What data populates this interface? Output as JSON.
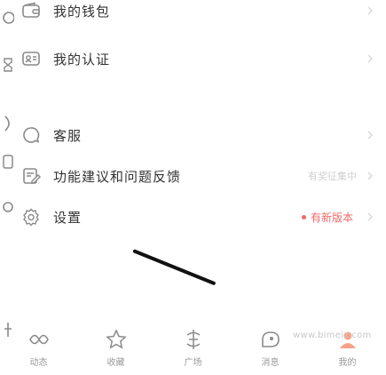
{
  "menu": [
    {
      "label": "我的钱包",
      "icon": "wallet-icon"
    },
    {
      "label": "我的认证",
      "icon": "id-card-icon"
    },
    {
      "label": "客服",
      "icon": "chat-icon"
    },
    {
      "label": "功能建议和问题反馈",
      "icon": "edit-icon",
      "sub": "有奖征集中"
    },
    {
      "label": "设置",
      "icon": "settings-icon",
      "badge": "有新版本"
    }
  ],
  "bottom_nav": [
    {
      "label": "动态",
      "icon": "dynamic-icon"
    },
    {
      "label": "收藏",
      "icon": "star-icon"
    },
    {
      "label": "广场",
      "icon": "plaza-icon"
    },
    {
      "label": "消息",
      "icon": "message-icon"
    },
    {
      "label": "我的",
      "icon": "profile-icon"
    }
  ],
  "watermark": "www.bimeiz.com",
  "colors": {
    "accent": "#f06a6a",
    "text": "#333333",
    "muted": "#999999",
    "icon": "#8a8a8a"
  }
}
